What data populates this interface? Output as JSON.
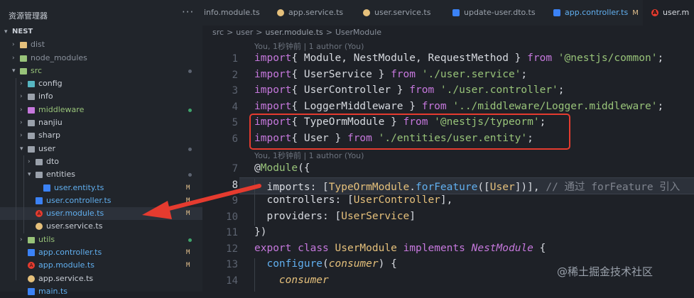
{
  "explorer": {
    "title": "资源管理器",
    "more": "···",
    "root_label": "NEST",
    "items": [
      {
        "label": "dist",
        "depth": 1,
        "type": "folder",
        "expanded": false,
        "color": "#e5c07b",
        "label_color": "#8a919c"
      },
      {
        "label": "node_modules",
        "depth": 1,
        "type": "folder",
        "expanded": false,
        "color": "#98c379",
        "label_color": "#8a919c"
      },
      {
        "label": "src",
        "depth": 1,
        "type": "folder",
        "expanded": true,
        "color": "#98c379",
        "label_color": "#98c379",
        "status": "dot"
      },
      {
        "label": "config",
        "depth": 2,
        "type": "folder",
        "expanded": false,
        "color": "#56b6c2",
        "label_color": "#c9ced6"
      },
      {
        "label": "info",
        "depth": 2,
        "type": "folder",
        "expanded": false,
        "color": "#9aa1ab",
        "label_color": "#c9ced6"
      },
      {
        "label": "middleware",
        "depth": 2,
        "type": "folder",
        "expanded": false,
        "color": "#c678dd",
        "label_color": "#98c379",
        "status": "dot-green"
      },
      {
        "label": "nanjiu",
        "depth": 2,
        "type": "folder",
        "expanded": false,
        "color": "#9aa1ab",
        "label_color": "#c9ced6"
      },
      {
        "label": "sharp",
        "depth": 2,
        "type": "folder",
        "expanded": false,
        "color": "#9aa1ab",
        "label_color": "#c9ced6"
      },
      {
        "label": "user",
        "depth": 2,
        "type": "folder",
        "expanded": true,
        "color": "#9aa1ab",
        "label_color": "#c9ced6",
        "status": "dot"
      },
      {
        "label": "dto",
        "depth": 3,
        "type": "folder",
        "expanded": false,
        "color": "#9aa1ab",
        "label_color": "#c9ced6"
      },
      {
        "label": "entities",
        "depth": 3,
        "type": "folder",
        "expanded": true,
        "color": "#9aa1ab",
        "label_color": "#c9ced6",
        "status": "dot"
      },
      {
        "label": "user.entity.ts",
        "depth": 4,
        "type": "ts",
        "color": "#3b82f6",
        "label_color": "#61afef",
        "status": "M"
      },
      {
        "label": "user.controller.ts",
        "depth": 3,
        "type": "ts",
        "color": "#3b82f6",
        "label_color": "#61afef",
        "status": "M"
      },
      {
        "label": "user.module.ts",
        "depth": 3,
        "type": "angular",
        "color": "#e53b2f",
        "label_color": "#61afef",
        "status": "M",
        "selected": true
      },
      {
        "label": "user.service.ts",
        "depth": 3,
        "type": "service",
        "color": "#e5c07b",
        "label_color": "#c9ced6"
      },
      {
        "label": "utils",
        "depth": 2,
        "type": "folder",
        "expanded": false,
        "color": "#98c379",
        "label_color": "#98c379",
        "status": "dot-green"
      },
      {
        "label": "app.controller.ts",
        "depth": 2,
        "type": "ts",
        "color": "#3b82f6",
        "label_color": "#61afef",
        "status": "M"
      },
      {
        "label": "app.module.ts",
        "depth": 2,
        "type": "angular",
        "color": "#e53b2f",
        "label_color": "#61afef",
        "status": "M"
      },
      {
        "label": "app.service.ts",
        "depth": 2,
        "type": "service",
        "color": "#e5c07b",
        "label_color": "#c9ced6"
      },
      {
        "label": "main.ts",
        "depth": 2,
        "type": "ts",
        "color": "#3b82f6",
        "label_color": "#61afef"
      }
    ]
  },
  "tabs": [
    {
      "label": "info.module.ts",
      "icon": "none",
      "color": "#9aa1ab"
    },
    {
      "label": "app.service.ts",
      "icon": "service-icon",
      "color": "#e5c07b"
    },
    {
      "label": "user.service.ts",
      "icon": "service-icon",
      "color": "#e5c07b"
    },
    {
      "label": "update-user.dto.ts",
      "icon": "ts-icon",
      "color": "#3b82f6"
    },
    {
      "label": "app.controller.ts",
      "icon": "ts-icon",
      "color": "#3b82f6",
      "modified": "M"
    },
    {
      "label": "user.m",
      "icon": "angular-icon",
      "color": "#e53b2f",
      "active": true
    }
  ],
  "breadcrumb": [
    "src",
    ">",
    "user",
    ">",
    "user.module.ts",
    ">",
    "UserModule"
  ],
  "editor": {
    "codelens_1": "You, 1秒钟前 | 1 author (You)",
    "codelens_2": "You, 1秒钟前 | 1 author (You)",
    "line_numbers": [
      "1",
      "2",
      "3",
      "4",
      "5",
      "6",
      "7",
      "8",
      "9",
      "10",
      "11",
      "12",
      "13",
      "14"
    ],
    "current_line": "8",
    "lines": [
      [
        [
          "kw",
          "import"
        ],
        [
          "",
          "{ Module, NestModule, RequestMethod } "
        ],
        [
          "kw",
          "from"
        ],
        [
          "str",
          " '@nestjs/common'"
        ],
        [
          "",
          ";"
        ]
      ],
      [
        [
          "kw",
          "import"
        ],
        [
          "",
          "{ UserService } "
        ],
        [
          "kw",
          "from"
        ],
        [
          "str",
          " './user.service'"
        ],
        [
          "",
          ";"
        ]
      ],
      [
        [
          "kw",
          "import"
        ],
        [
          "",
          "{ UserController } "
        ],
        [
          "kw",
          "from"
        ],
        [
          "str",
          " './user.controller'"
        ],
        [
          "",
          ";"
        ]
      ],
      [
        [
          "kw",
          "import"
        ],
        [
          "",
          "{ LoggerMiddleware } "
        ],
        [
          "kw",
          "from"
        ],
        [
          "str",
          " '../middleware/Logger.middleware'"
        ],
        [
          "",
          ";"
        ]
      ],
      [
        [
          "kw",
          "import"
        ],
        [
          "",
          "{ TypeOrmModule } "
        ],
        [
          "kw",
          "from"
        ],
        [
          "str",
          " '@nestjs/typeorm'"
        ],
        [
          "",
          ";"
        ]
      ],
      [
        [
          "kw",
          "import"
        ],
        [
          "",
          "{ User } "
        ],
        [
          "kw",
          "from"
        ],
        [
          "str",
          " './entities/user.entity'"
        ],
        [
          "",
          ";"
        ]
      ],
      [
        [
          "",
          "@"
        ],
        [
          "dec",
          "Module"
        ],
        [
          "",
          "({"
        ]
      ],
      [
        [
          "",
          "  imports: ["
        ],
        [
          "cls",
          "TypeOrmModule"
        ],
        [
          "",
          "."
        ],
        [
          "fn",
          "forFeature"
        ],
        [
          "",
          "(["
        ],
        [
          "cls",
          "User"
        ],
        [
          "",
          "])],"
        ],
        [
          "cm",
          " // 通过 forFeature 引入"
        ]
      ],
      [
        [
          "",
          "  controllers: ["
        ],
        [
          "cls",
          "UserController"
        ],
        [
          "",
          "],"
        ]
      ],
      [
        [
          "",
          "  providers: ["
        ],
        [
          "cls",
          "UserService"
        ],
        [
          "",
          "]"
        ]
      ],
      [
        [
          "",
          "})"
        ]
      ],
      [
        [
          "kw",
          "export"
        ],
        [
          "",
          " "
        ],
        [
          "kw",
          "class"
        ],
        [
          "",
          " "
        ],
        [
          "cls",
          "UserModule"
        ],
        [
          "",
          " "
        ],
        [
          "kw",
          "implements"
        ],
        [
          "",
          " "
        ],
        [
          "it",
          "NestModule"
        ],
        [
          "",
          " {"
        ]
      ],
      [
        [
          "",
          "  "
        ],
        [
          "fn",
          "configure"
        ],
        [
          "",
          "("
        ],
        [
          "par",
          "consumer"
        ],
        [
          "",
          ") {"
        ]
      ],
      [
        [
          "",
          "    "
        ],
        [
          "par",
          "consumer"
        ]
      ]
    ]
  },
  "watermark": "@稀土掘金技术社区",
  "colors": {
    "highlight": "#e53b2f",
    "arrow": "#e53b2f"
  }
}
